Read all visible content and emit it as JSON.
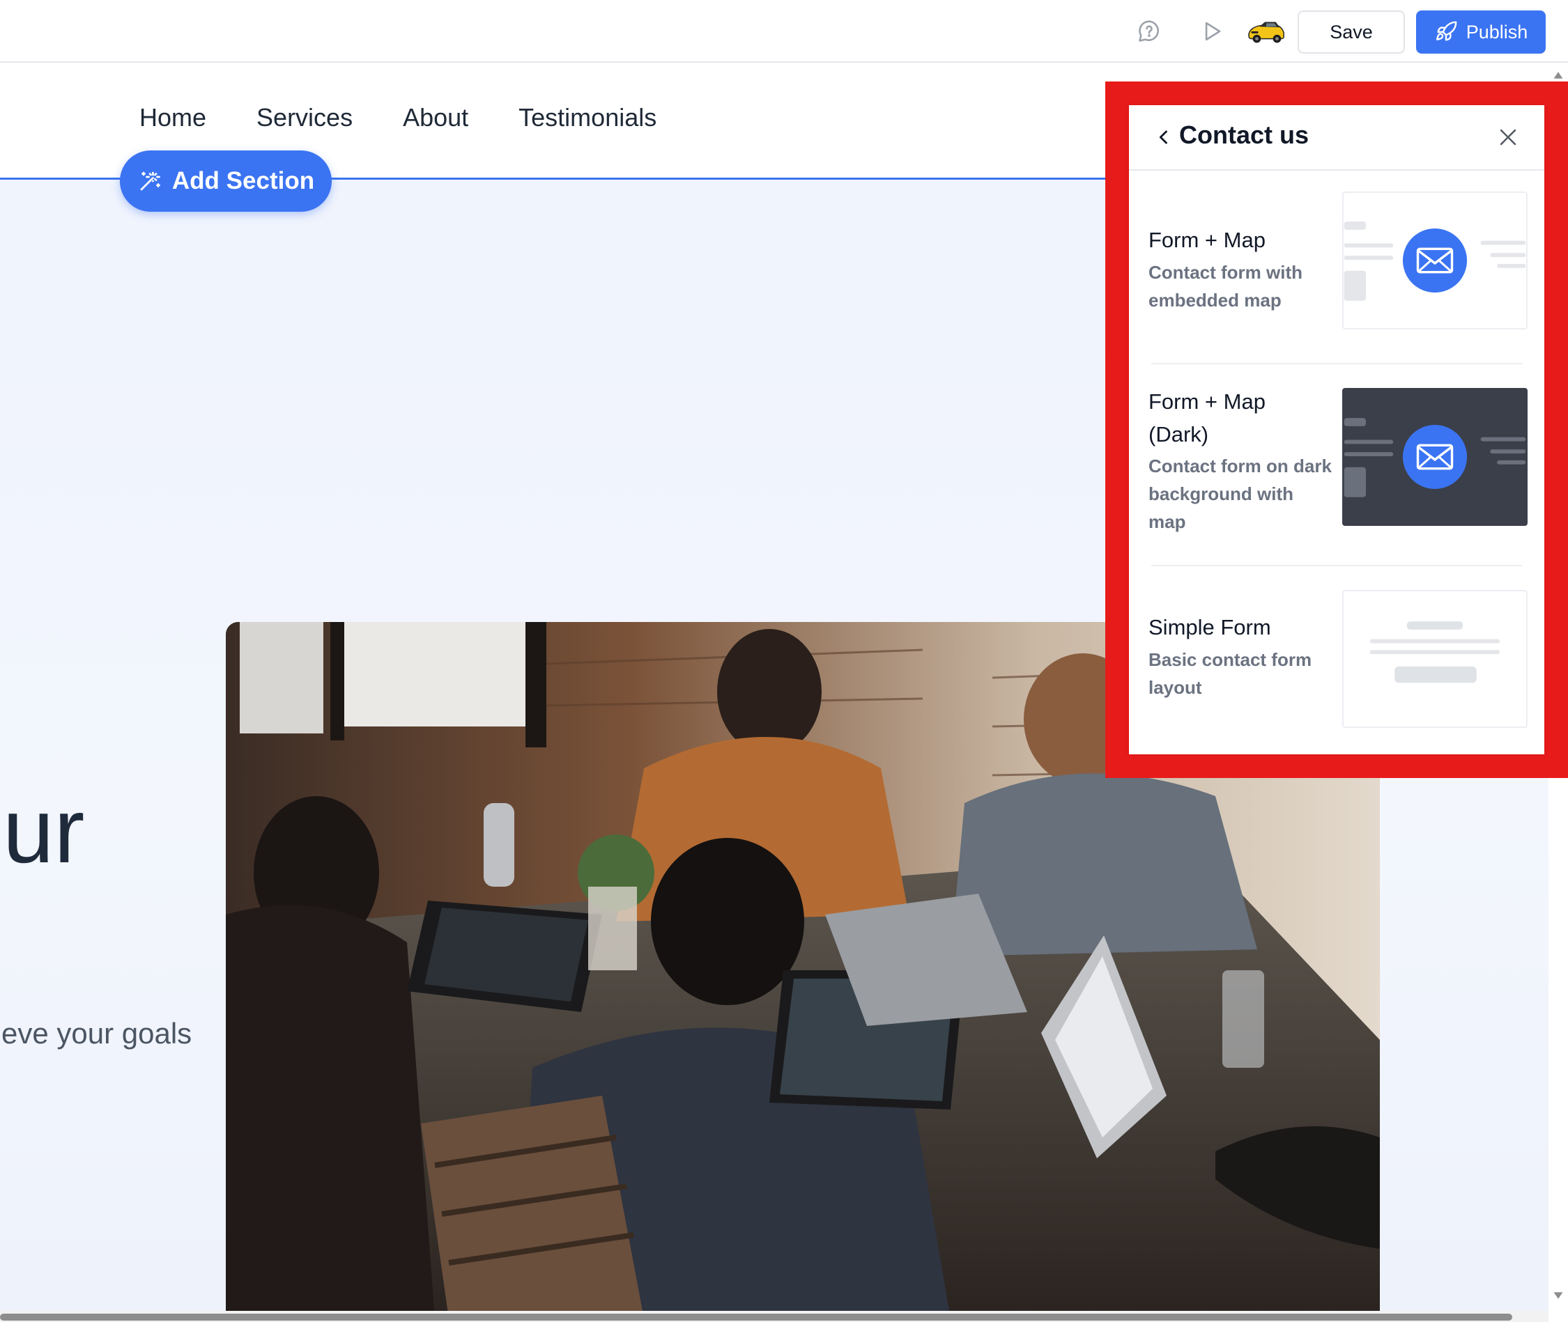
{
  "toolbar": {
    "icons": [
      "chat-help-icon",
      "play-preview-icon"
    ],
    "avatar": "car-avatar",
    "save_label": "Save",
    "publish_label": "Publish"
  },
  "site": {
    "nav": [
      "Home",
      "Services",
      "About",
      "Testimonials"
    ],
    "add_section_label": "Add Section",
    "hero_fragment": "ur",
    "hero_subtitle_fragment": "eve your goals"
  },
  "panel": {
    "title": "Contact us",
    "options": [
      {
        "title_lines": [
          "Form + Map"
        ],
        "desc_lines": [
          "Contact form with",
          "embedded map"
        ],
        "thumb": "light-form-map"
      },
      {
        "title_lines": [
          "Form + Map",
          "(Dark)"
        ],
        "desc_lines": [
          "Contact form on dark",
          "background with",
          "map"
        ],
        "thumb": "dark-form-map"
      },
      {
        "title_lines": [
          "Simple Form"
        ],
        "desc_lines": [
          "Basic contact form",
          "layout"
        ],
        "thumb": "simple-form"
      }
    ]
  },
  "colors": {
    "accent": "#3b74f2",
    "highlight": "#e81b1b",
    "dark_thumb": "#3b3f4a"
  }
}
